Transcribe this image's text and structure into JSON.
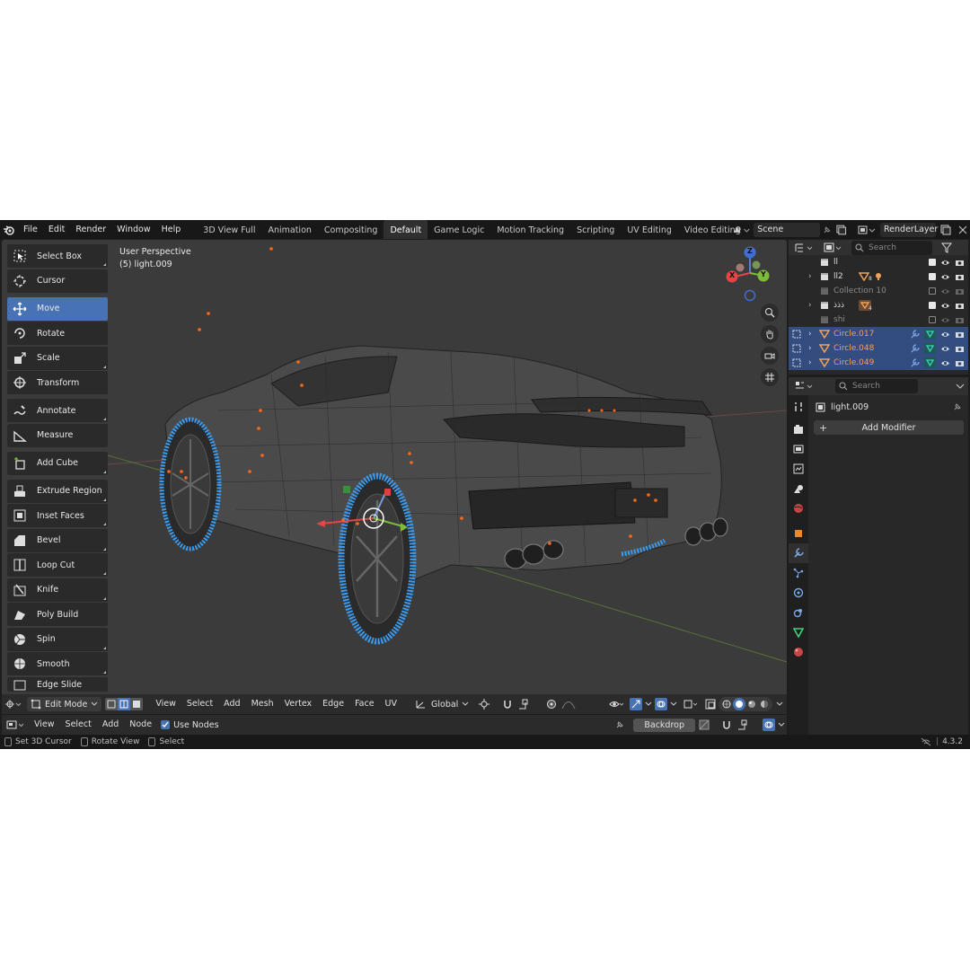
{
  "topbar": {
    "menus": [
      "File",
      "Edit",
      "Render",
      "Window",
      "Help"
    ],
    "workspaces": [
      "3D View Full",
      "Animation",
      "Compositing",
      "Default",
      "Game Logic",
      "Motion Tracking",
      "Scripting",
      "UV Editing",
      "Video Editing"
    ],
    "active_workspace": "Default",
    "add_workspace": "+",
    "scene": "Scene",
    "render_layer": "RenderLayer"
  },
  "viewport": {
    "perspective": "User Perspective",
    "object": "(5) light.009"
  },
  "tools": [
    {
      "label": "Select Box",
      "icon": "select-box-icon"
    },
    {
      "label": "Cursor",
      "icon": "cursor-icon"
    },
    {
      "label": "Move",
      "icon": "move-icon"
    },
    {
      "label": "Rotate",
      "icon": "rotate-icon"
    },
    {
      "label": "Scale",
      "icon": "scale-icon"
    },
    {
      "label": "Transform",
      "icon": "transform-icon"
    },
    {
      "label": "Annotate",
      "icon": "annotate-icon"
    },
    {
      "label": "Measure",
      "icon": "measure-icon"
    },
    {
      "label": "Add Cube",
      "icon": "add-cube-icon"
    },
    {
      "label": "Extrude Region",
      "icon": "extrude-icon"
    },
    {
      "label": "Inset Faces",
      "icon": "inset-icon"
    },
    {
      "label": "Bevel",
      "icon": "bevel-icon"
    },
    {
      "label": "Loop Cut",
      "icon": "loop-cut-icon"
    },
    {
      "label": "Knife",
      "icon": "knife-icon"
    },
    {
      "label": "Poly Build",
      "icon": "poly-build-icon"
    },
    {
      "label": "Spin",
      "icon": "spin-icon"
    },
    {
      "label": "Smooth",
      "icon": "smooth-icon"
    },
    {
      "label": "Edge Slide",
      "icon": "edge-slide-icon"
    }
  ],
  "gizmo": {
    "z": "Z",
    "y": "Y",
    "x": "X"
  },
  "viewport_header": {
    "mode": "Edit Mode",
    "menus": [
      "View",
      "Select",
      "Add",
      "Mesh",
      "Vertex",
      "Edge",
      "Face",
      "UV"
    ],
    "orientation": "Global"
  },
  "node_header": {
    "menus": [
      "View",
      "Select",
      "Add",
      "Node"
    ],
    "use_nodes": "Use Nodes",
    "backdrop": "Backdrop"
  },
  "statusbar": {
    "items": [
      "Set 3D Cursor",
      "Rotate View",
      "Select"
    ],
    "version": "4.3.2"
  },
  "outliner": {
    "search_placeholder": "Search",
    "rows": [
      {
        "name": "ll",
        "expand": false,
        "state": "normal",
        "checked": true
      },
      {
        "name": "ll2",
        "expand": true,
        "state": "normal",
        "checked": true,
        "badge": "8"
      },
      {
        "name": "Collection 10",
        "expand": false,
        "state": "dim",
        "checked": false
      },
      {
        "name": "ذذذ",
        "expand": true,
        "state": "normal",
        "checked": true,
        "badge": "4"
      },
      {
        "name": "shi",
        "expand": false,
        "state": "dim",
        "checked": false
      },
      {
        "name": "Circle.017",
        "expand": true,
        "state": "selected"
      },
      {
        "name": "Circle.048",
        "expand": true,
        "state": "selected"
      },
      {
        "name": "Circle.049",
        "expand": true,
        "state": "selected"
      }
    ]
  },
  "properties": {
    "search_placeholder": "Search",
    "object_name": "light.009",
    "add_modifier": "Add Modifier",
    "add_symbol": "+"
  },
  "colors": {
    "accent": "#4772b3",
    "selected_orange": "#f0a15a",
    "mesh_blue": "#3a9bf0",
    "vertex_orange": "#ff6a1a"
  }
}
